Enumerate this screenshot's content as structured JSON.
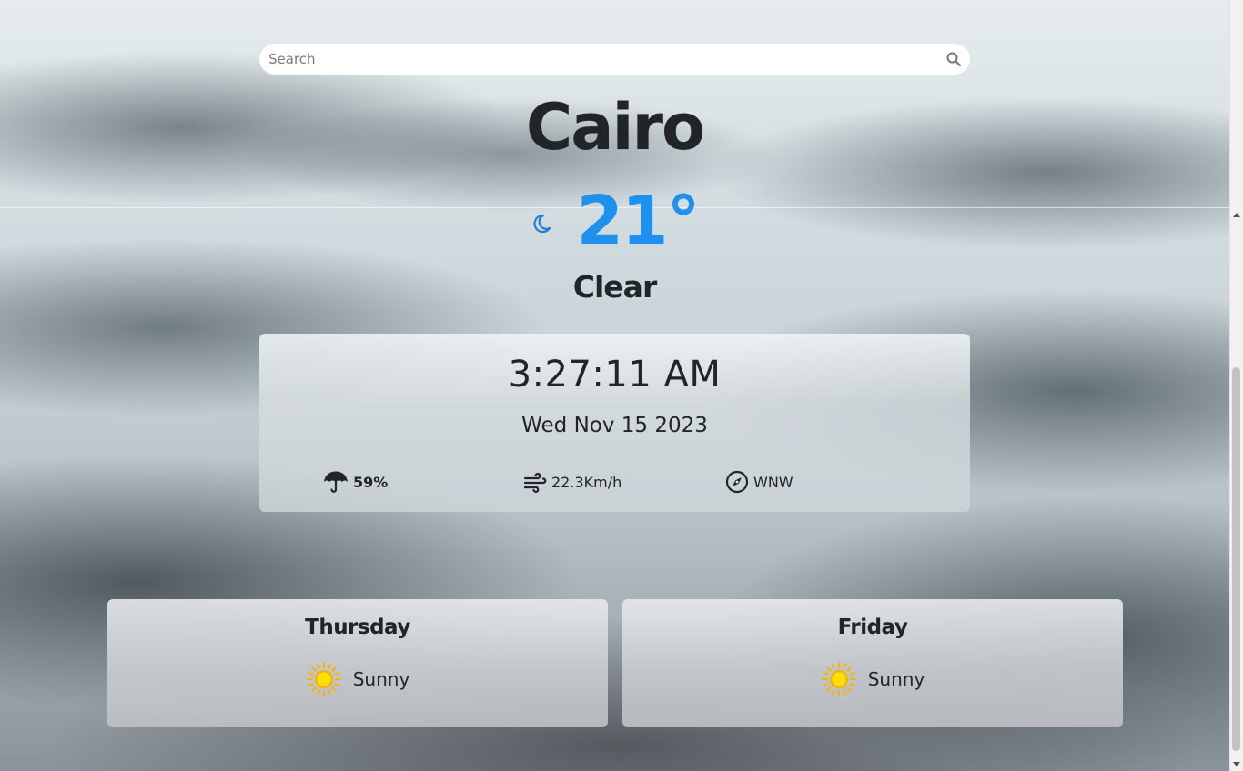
{
  "search": {
    "placeholder": "Search"
  },
  "current": {
    "city": "Cairo",
    "temperature": "21°",
    "condition": "Clear",
    "icon": "moon-icon"
  },
  "details": {
    "time": "3:27:11 AM",
    "date": "Wed Nov 15 2023",
    "humidity": "59%",
    "wind_speed": "22.3Km/h",
    "wind_direction": "WNW"
  },
  "forecast": [
    {
      "day": "Thursday",
      "condition": "Sunny",
      "icon": "sun-icon"
    },
    {
      "day": "Friday",
      "condition": "Sunny",
      "icon": "sun-icon"
    }
  ],
  "colors": {
    "temperature": "#1e90ee",
    "text": "#212529",
    "sun": "#ffd000"
  }
}
